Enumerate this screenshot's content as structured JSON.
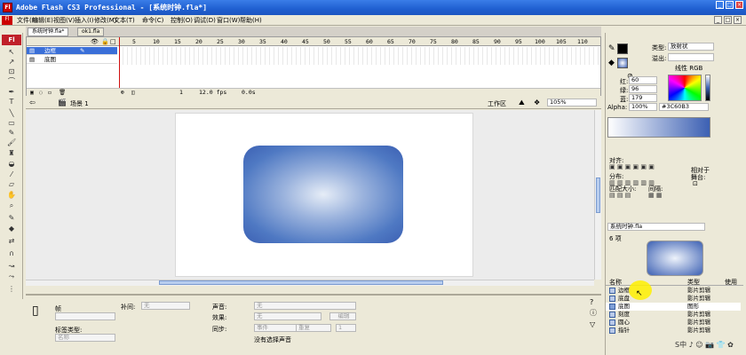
{
  "window": {
    "title": "Adobe Flash CS3 Professional - [系统时钟.fla*]",
    "icon_label": "Fl"
  },
  "menu": [
    "文件(F)",
    "编辑(E)",
    "视图(V)",
    "插入(I)",
    "修改(M)",
    "文本(T)",
    "命令(C)",
    "控制(O)",
    "调试(D)",
    "窗口(W)",
    "帮助(H)"
  ],
  "tabs": [
    "系统时钟.fla*",
    "ok1.fla"
  ],
  "toolbox_label": "Fl",
  "timeline": {
    "frame_numbers": [
      "5",
      "10",
      "15",
      "20",
      "25",
      "30",
      "35",
      "40",
      "45",
      "50",
      "55",
      "60",
      "65",
      "70",
      "75",
      "80",
      "85",
      "90",
      "95",
      "100",
      "105",
      "110"
    ],
    "layers": [
      "边框",
      "底图"
    ],
    "frame": "1",
    "fps": "12.0 fps",
    "time": "0.0s"
  },
  "editbar": {
    "scene": "场景 1",
    "workspace": "工作区",
    "zoom": "105%"
  },
  "properties": {
    "frame_label": "帧",
    "tween_label": "补间:",
    "tween_value": "无",
    "label_type_label": "标签类型:",
    "label_type_value": "名称",
    "sound_label": "声音:",
    "sound_value": "无",
    "effect_label": "效果:",
    "effect_value": "无",
    "edit_button": "编辑",
    "sync_label": "同步:",
    "sync_value": "事件",
    "repeat_value": "重复",
    "repeat_count": "1",
    "no_sound": "没有选择声音"
  },
  "color_panel": {
    "type_label": "类型:",
    "type_value": "放射状",
    "overflow_label": "溢出:",
    "linear_rgb": "线性 RGB",
    "r_label": "红:",
    "r_value": "60",
    "g_label": "绿:",
    "g_value": "96",
    "b_label": "蓝:",
    "b_value": "179",
    "alpha_label": "Alpha:",
    "alpha_value": "100%",
    "hex": "#3C60B3",
    "gradient_start": "#ffffff",
    "gradient_end": "#3c60b3"
  },
  "align_panel": {
    "title": "对齐:",
    "distribute": "分布:",
    "match_size": "匹配大小:",
    "spacing": "间隔:",
    "to_stage_1": "相对于",
    "to_stage_2": "舞台:"
  },
  "library": {
    "file": "系统时钟.fla",
    "count": "6 项",
    "col_name": "名称",
    "col_type": "类型",
    "col_use": "使用",
    "items": [
      {
        "name": "边框",
        "type": "影片剪辑"
      },
      {
        "name": "底盘",
        "type": "影片剪辑"
      },
      {
        "name": "底图",
        "type": "图形"
      },
      {
        "name": "刻度",
        "type": "影片剪辑"
      },
      {
        "name": "圆心",
        "type": "影片剪辑"
      },
      {
        "name": "指针",
        "type": "影片剪辑"
      }
    ]
  },
  "watermark": "S中 ♪ ☺ 📷 👕 ✿"
}
